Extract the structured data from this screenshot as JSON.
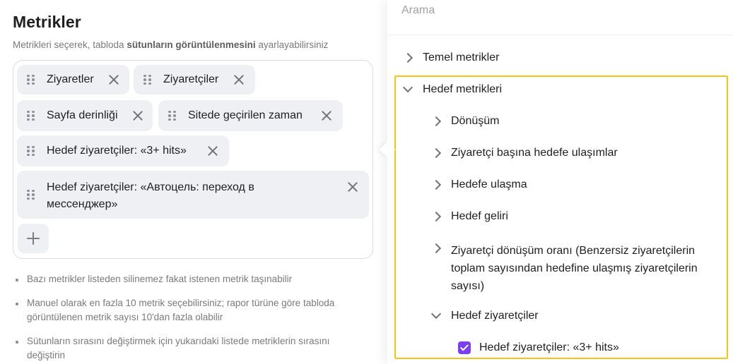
{
  "metrics": {
    "title": "Metrikler",
    "subtitle_pre": "Metrikleri seçerek, tabloda ",
    "subtitle_bold": "sütunların görüntülenmesini",
    "subtitle_post": " ayarlayabilirsiniz",
    "chips": [
      "Ziyaretler",
      "Ziyaretçiler",
      "Sayfa derinliği",
      "Sitede geçirilen zaman",
      "Hedef ziyaretçiler: «3+ hits»",
      "Hedef ziyaretçiler: «Автоцель: переход в",
      "мессенджер»"
    ],
    "notes": [
      "Bazı metrikler listeden silinemez fakat istenen metrik taşınabilir",
      "Manuel olarak en fazla 10 metrik seçebilirsiniz; rapor türüne göre tabloda",
      "görüntülenen metrik sayısı 10'dan fazla olabilir",
      "Sütunların sırasını değiştirmek için yukarıdaki listede metriklerin sırasını",
      "değiştirin"
    ]
  },
  "panel": {
    "search_placeholder": "Arama",
    "items": [
      "Temel metrikler",
      "Hedef metrikleri",
      "Dönüşüm",
      "Ziyaretçi başına hedefe ulaşımlar",
      "Hedefe ulaşma",
      "Hedef geliri",
      "Ziyaretçi dönüşüm oranı (Benzersiz ziyaretçilerin",
      "toplam sayısından hedefine ulaşmış ziyaretçilerin",
      "sayısı)",
      "Hedef ziyaretçiler",
      "Hedef ziyaretçiler: «3+ hits»"
    ]
  },
  "colors": {
    "highlight": "#f5c518",
    "checkbox": "#7b3ff2",
    "chip_bg": "#eef0f4"
  },
  "icons": [
    "drag-handle-icon",
    "close-icon",
    "plus-icon",
    "chevron-right-icon",
    "chevron-down-icon",
    "checkbox-checked-icon"
  ]
}
